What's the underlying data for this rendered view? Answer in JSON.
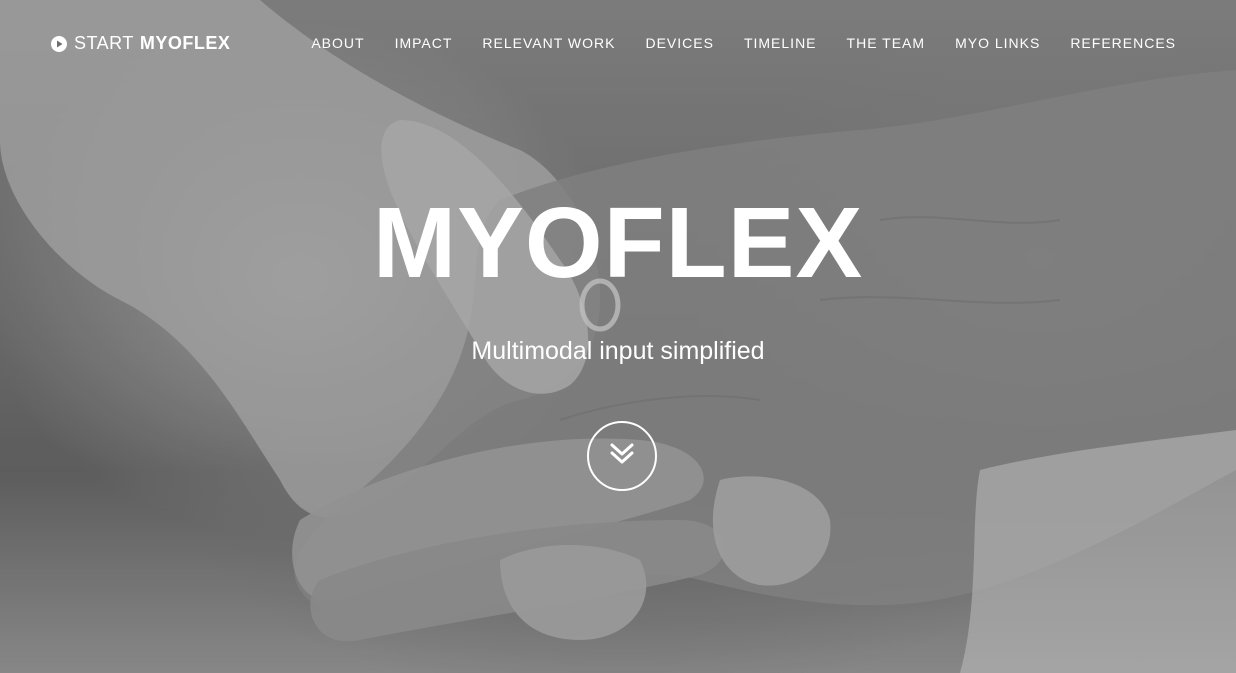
{
  "brand": {
    "start_label": "START",
    "name_label": "MYOFLEX",
    "icon": "play-circle-icon"
  },
  "nav": {
    "items": [
      {
        "label": "ABOUT"
      },
      {
        "label": "IMPACT"
      },
      {
        "label": "RELEVANT WORK"
      },
      {
        "label": "DEVICES"
      },
      {
        "label": "TIMELINE"
      },
      {
        "label": "THE TEAM"
      },
      {
        "label": "MYO LINKS"
      },
      {
        "label": "REFERENCES"
      }
    ]
  },
  "hero": {
    "title": "MYOFLEX",
    "subtitle": "Multimodal input simplified",
    "scroll_icon": "double-chevron-down-icon"
  },
  "colors": {
    "text": "#ffffff",
    "background_tone": "#7a7a7a"
  }
}
